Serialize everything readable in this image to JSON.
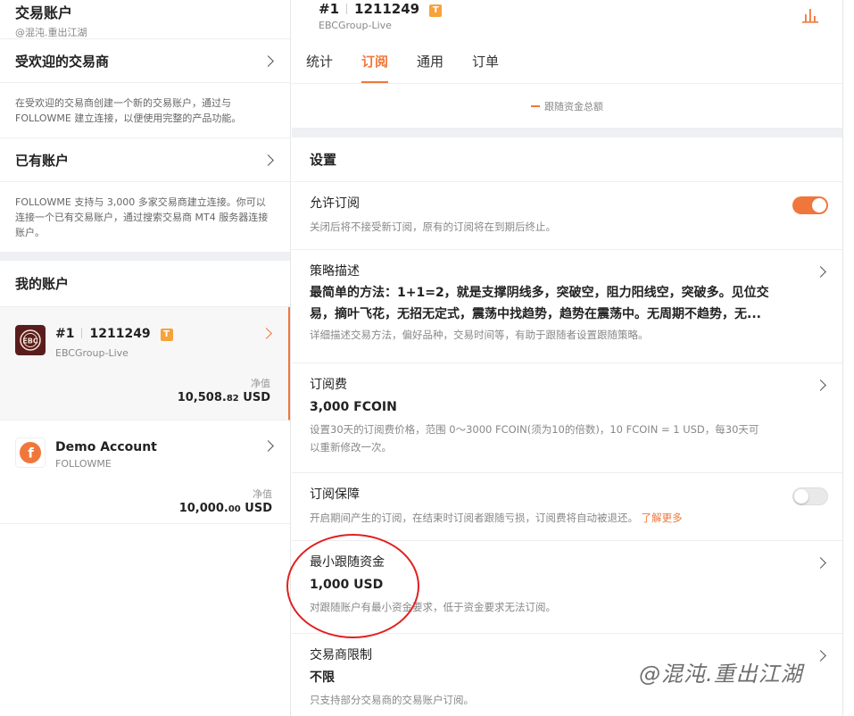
{
  "left": {
    "title": "交易账户",
    "subtitle": "@混沌.重出江湖",
    "popular": {
      "label": "受欢迎的交易商",
      "desc": "在受欢迎的交易商创建一个新的交易账户，通过与 FOLLOWME 建立连接，以便使用完整的产品功能。"
    },
    "existing": {
      "label": "已有账户",
      "desc": "FOLLOWME 支持与 3,000 多家交易商建立连接。你可以连接一个已有交易账户，通过搜索交易商 MT4 服务器连接账户。"
    },
    "my_accounts_title": "我的账户",
    "accounts": [
      {
        "index": "#1",
        "number": "1211249",
        "badge": "T",
        "broker": "EBCGroup-Live",
        "nv_label": "净值",
        "nv_main": "10,508.",
        "nv_cents": "82",
        "nv_unit": " USD"
      },
      {
        "name": "Demo Account",
        "broker": "FOLLOWME",
        "nv_label": "净值",
        "nv_main": "10,000.",
        "nv_cents": "00",
        "nv_unit": " USD"
      }
    ]
  },
  "right": {
    "header": {
      "index": "#1",
      "number": "1211249",
      "badge": "T",
      "broker": "EBCGroup-Live"
    },
    "tabs": [
      "统计",
      "订阅",
      "通用",
      "订单"
    ],
    "legend": "跟随资金总额",
    "settings_title": "设置",
    "items": {
      "allow": {
        "title": "允许订阅",
        "hint": "关闭后将不接受新订阅，原有的订阅将在到期后终止。"
      },
      "strategy": {
        "title": "策略描述",
        "value_line1": "最简单的方法：1+1=2，就是支撑阴线多，突破空，阻力阳线空，突破多。见位交",
        "value_line2": "易，摘叶飞花，无招无定式，震荡中找趋势，趋势在震荡中。无周期不趋势，无...",
        "hint": "详细描述交易方法，偏好品种，交易时间等，有助于跟随者设置跟随策略。"
      },
      "fee": {
        "title": "订阅费",
        "value": "3,000 FCOIN",
        "hint_line1": "设置30天的订阅费价格，范围 0～3000 FCOIN(须为10的倍数)，10 FCOIN = 1 USD，每30天可",
        "hint_line2": "以重新修改一次。"
      },
      "guarantee": {
        "title": "订阅保障",
        "hint": "开启期间产生的订阅，在结束时订阅者跟随亏损，订阅费将自动被退还。",
        "more": "了解更多"
      },
      "min_fund": {
        "title": "最小跟随资金",
        "value": "1,000 USD",
        "hint": "对跟随账户有最小资金要求，低于资金要求无法订阅。"
      },
      "broker_limit": {
        "title": "交易商限制",
        "value": "不限",
        "hint": "只支持部分交易商的交易账户订阅。"
      }
    }
  },
  "watermark": "@混沌.重出江湖",
  "colors": {
    "accent": "#f0773b",
    "badge": "#f7a23a",
    "highlight_circle": "#e02020"
  },
  "toggles": {
    "allow_subscription": true,
    "subscription_guarantee": false
  }
}
